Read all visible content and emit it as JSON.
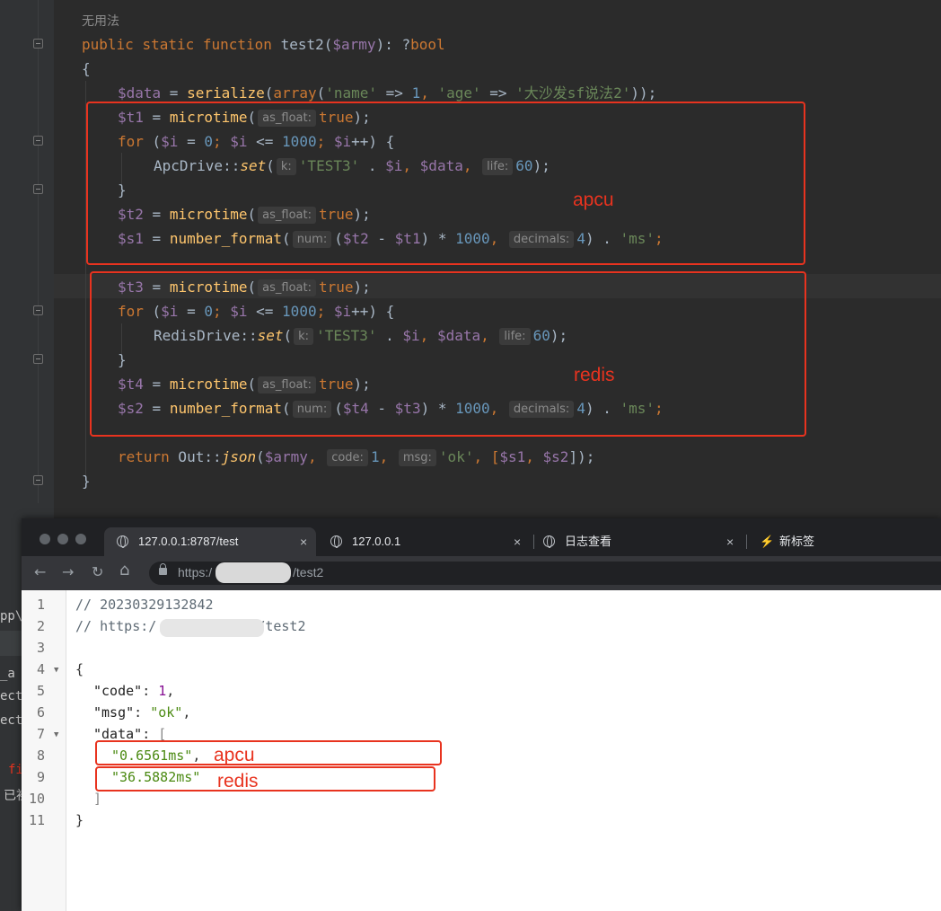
{
  "ide": {
    "comment_line": "无用法",
    "func_sig": {
      "kw1": "public",
      "kw2": "static",
      "kw3": "function",
      "name": "test2",
      "p_open": "(",
      "param": "$army",
      "p_close": "): ?",
      "ret": "bool"
    },
    "brace_open": "{",
    "brace_close": "}",
    "data_line": {
      "var": "$data",
      "eq": " = ",
      "fn": "serialize",
      "p1": "(",
      "kw": "array",
      "p2": "(",
      "s1": "'name'",
      "arrow1": " => ",
      "n1": "1",
      "c1": ", ",
      "s2": "'age'",
      "arrow2": " => ",
      "s3": "'大沙发sf说法2'",
      "end": "));"
    },
    "apcu_block": {
      "t1": {
        "var": "$t1",
        "eq": " = ",
        "fn": "microtime",
        "open": "(",
        "hint": "as_float:",
        "val": "true",
        "end": ");"
      },
      "for": {
        "kw": "for",
        "a": " (",
        "v1": "$i",
        "b": " = ",
        "n0": "0",
        "c": "; ",
        "v2": "$i",
        "d": " <= ",
        "n1000": "1000",
        "e": "; ",
        "v3": "$i",
        "f": "++) {"
      },
      "call": {
        "cls": "ApcDrive",
        "sep": "::",
        "fn": "set",
        "open": "(",
        "hint_k": "k:",
        "s": "'TEST3'",
        "dot": " . ",
        "v_i": "$i",
        "comma": ", ",
        "v_data": "$data",
        "comma2": ", ",
        "hint_life": "life:",
        "n": "60",
        "end": ");"
      },
      "close": "}",
      "t2": {
        "var": "$t2",
        "eq": " = ",
        "fn": "microtime",
        "open": "(",
        "hint": "as_float:",
        "val": "true",
        "end": ");"
      },
      "s1": {
        "var": "$s1",
        "eq": " = ",
        "fn": "number_format",
        "open": "(",
        "hint_num": "num:",
        "expr_a": "(",
        "va": "$t2",
        "minus": " - ",
        "vb": "$t1",
        "expr_b": ") * ",
        "n": "1000",
        "comma": ", ",
        "hint_dec": "decimals:",
        "n4": "4",
        "tail": ") . ",
        "s": "'ms'",
        "end": ";"
      }
    },
    "redis_block": {
      "t3": {
        "var": "$t3",
        "eq": " = ",
        "fn": "microtime",
        "open": "(",
        "hint": "as_float:",
        "val": "true",
        "end": ");"
      },
      "for": {
        "kw": "for",
        "a": " (",
        "v1": "$i",
        "b": " = ",
        "n0": "0",
        "c": "; ",
        "v2": "$i",
        "d": " <= ",
        "n1000": "1000",
        "e": "; ",
        "v3": "$i",
        "f": "++) {"
      },
      "call": {
        "cls": "RedisDrive",
        "sep": "::",
        "fn": "set",
        "open": "(",
        "hint_k": "k:",
        "s": "'TEST3'",
        "dot": " . ",
        "v_i": "$i",
        "comma": ", ",
        "v_data": "$data",
        "comma2": ", ",
        "hint_life": "life:",
        "n": "60",
        "end": ");"
      },
      "close": "}",
      "t4": {
        "var": "$t4",
        "eq": " = ",
        "fn": "microtime",
        "open": "(",
        "hint": "as_float:",
        "val": "true",
        "end": ");"
      },
      "s2": {
        "var": "$s2",
        "eq": " = ",
        "fn": "number_format",
        "open": "(",
        "hint_num": "num:",
        "expr_a": "(",
        "va": "$t4",
        "minus": " - ",
        "vb": "$t3",
        "expr_b": ") * ",
        "n": "1000",
        "comma": ", ",
        "hint_dec": "decimals:",
        "n4": "4",
        "tail": ") . ",
        "s": "'ms'",
        "end": ";"
      }
    },
    "return_line": {
      "kw": "return",
      "cls": " Out",
      "sep": "::",
      "fn": "json",
      "open": "(",
      "v": "$army",
      "c1": ", ",
      "hint_code": "code:",
      "n": "1",
      "c2": ", ",
      "hint_msg": "msg:",
      "s": "'ok'",
      "c3": ", [",
      "v1": "$s1",
      "c4": ", ",
      "v2": "$s2",
      "end": "]);"
    },
    "annot_apcu": "apcu",
    "annot_redis": "redis",
    "left_fragments": [
      "pp\\",
      "_a",
      "ect",
      "ect",
      "fi",
      "已初"
    ]
  },
  "browser": {
    "tabs": [
      {
        "label": "127.0.0.1:8787/test",
        "close": "×"
      },
      {
        "label": "127.0.0.1",
        "close": "×"
      },
      {
        "label": "日志查看",
        "close": "×"
      },
      {
        "label": "新标签",
        "close": ""
      }
    ],
    "nav": {
      "back": "←",
      "forward": "→",
      "reload": "↻",
      "home": "⌂"
    },
    "url_prefix": "https:/",
    "url_suffix": "/test2",
    "json_lines": {
      "l1": "// 20230329132842",
      "l2a": "// https:/",
      "l2b": "/test2",
      "l4": "{",
      "l5": {
        "key": "\"code\"",
        "colon": ": ",
        "val": "1",
        "end": ","
      },
      "l6": {
        "key": "\"msg\"",
        "colon": ": ",
        "val": "\"ok\"",
        "end": ","
      },
      "l7": {
        "key": "\"data\"",
        "colon": ": ",
        "val": "["
      },
      "l8": {
        "val": "\"0.6561ms\"",
        "end": ","
      },
      "l9": {
        "val": "\"36.5882ms\""
      },
      "l10": "]",
      "l11": "}"
    },
    "line_numbers": [
      "1",
      "2",
      "3",
      "4",
      "5",
      "6",
      "7",
      "8",
      "9",
      "10",
      "11"
    ],
    "annot_apcu": "apcu",
    "annot_redis": "redis"
  }
}
